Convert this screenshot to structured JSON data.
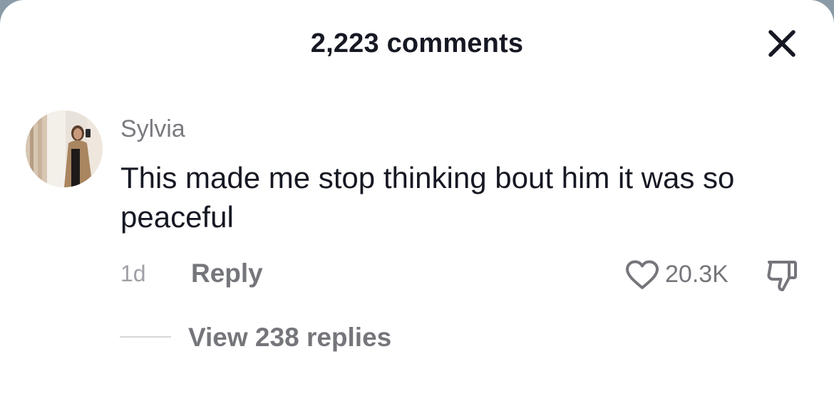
{
  "header": {
    "title": "2,223 comments",
    "close_icon": "close-icon"
  },
  "comment": {
    "username": "Sylvia",
    "text": "This made me stop thinking bout him it was so peaceful",
    "timestamp": "1d",
    "reply_label": "Reply",
    "like_count": "20.3K",
    "like_icon": "heart-outline-icon",
    "dislike_icon": "thumbs-down-icon",
    "view_replies_label": "View 238 replies"
  },
  "colors": {
    "primary_text": "#161823",
    "secondary_text": "#75767b",
    "muted_text": "#a0a1a6",
    "background": "#ffffff"
  }
}
